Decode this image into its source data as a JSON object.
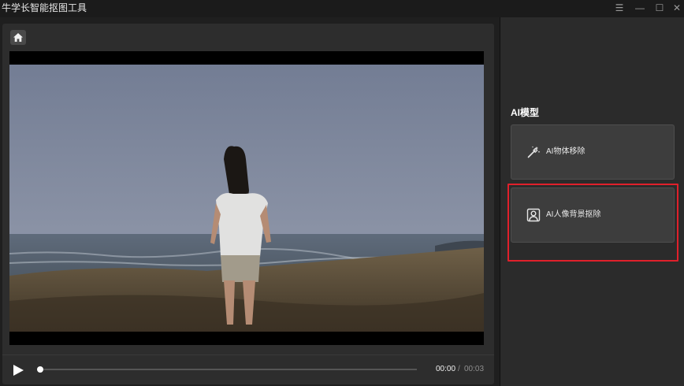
{
  "window": {
    "title": "牛学长智能抠图工具",
    "controls": {
      "menu": "☰",
      "minimize": "—",
      "maximize": "☐",
      "close": "✕"
    }
  },
  "player": {
    "current_time": "00:00",
    "separator": "/",
    "total_time": "00:03",
    "progress_fraction": 0.0
  },
  "sidebar": {
    "section_title": "AI模型",
    "models": [
      {
        "label": "AI物体移除",
        "icon": "magic-wand-icon",
        "selected": false
      },
      {
        "label": "AI人像背景抠除",
        "icon": "portrait-icon",
        "selected": true
      }
    ],
    "highlight_color": "#e0202b"
  },
  "colors": {
    "background": "#1f1f1f",
    "panel": "#2d2d2d",
    "card": "#3d3d3d"
  }
}
